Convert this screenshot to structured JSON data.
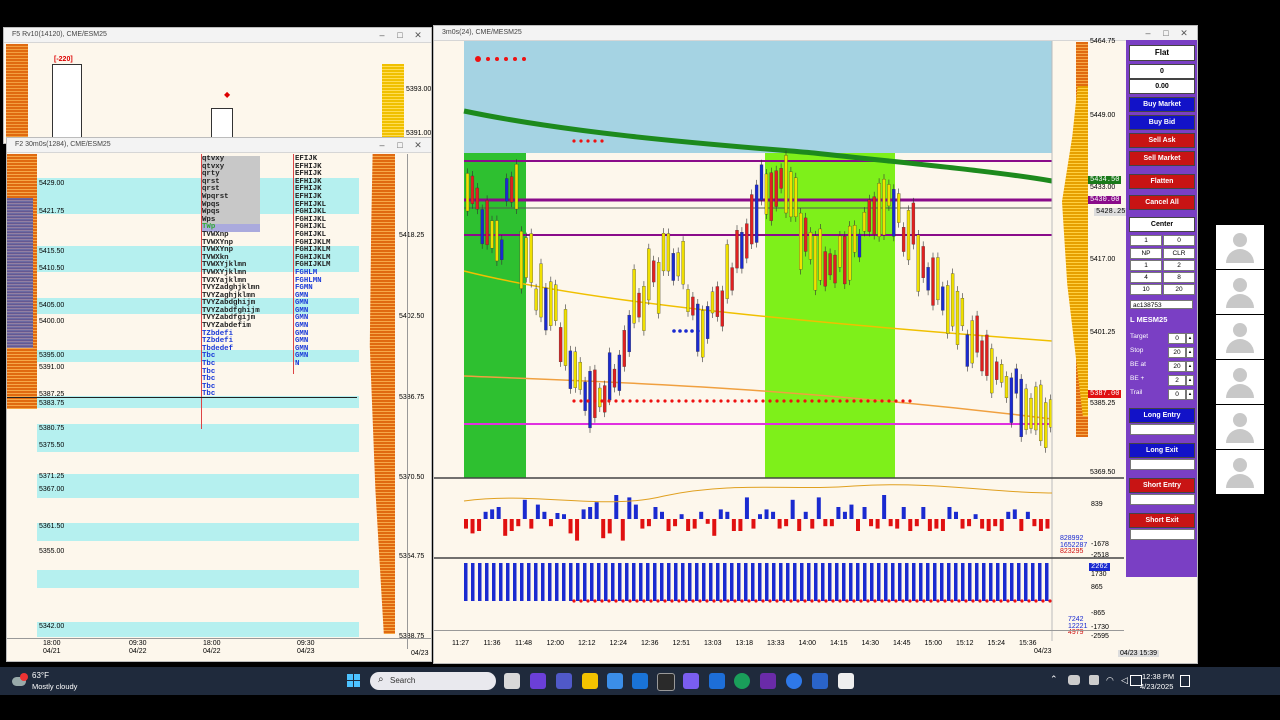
{
  "left_window": {
    "title": "F2 30m0s(1284), CME/ESM25",
    "mini_title": "F5 Rv10(14120), CME/ESM25",
    "mini_badge": "[-220]",
    "right_axis": [
      "5418.25",
      "5402.50",
      "5386.75",
      "5370.50",
      "5354.75",
      "5338.75"
    ],
    "mini_axis": [
      "5393.00",
      "5391.00"
    ],
    "price_labels": [
      "5429.00",
      "5421.75",
      "5415.50",
      "5410.50",
      "5405.00",
      "5400.00",
      "5395.00",
      "5391.00",
      "5387.25",
      "5383.75",
      "5380.75",
      "5375.50",
      "5371.25",
      "5367.00",
      "5361.50",
      "5355.00",
      "5342.00"
    ],
    "x_labels": [
      {
        "time": "18:00",
        "date": "04/21"
      },
      {
        "time": "09:30",
        "date": "04/22"
      },
      {
        "time": "18:00",
        "date": "04/22"
      },
      {
        "time": "09:30",
        "date": "04/23"
      }
    ],
    "corner_date": "04/23",
    "tpo_col1": [
      "qtvxy",
      "qtvxy",
      "qrty",
      "qrst",
      "qrst",
      "Wpqrst",
      "Wpqs",
      "Wpqs",
      "Wps",
      "TWp",
      "TVWXnp",
      "TVWXYnp",
      "TVWXYnp",
      "TVWXkn",
      "TVWXYjklmn",
      "TVWXYjklmn",
      "TVXYajklmn",
      "TVYZadghjklmn",
      "TVYZaghjklmn",
      "TVYZabdghijm",
      "TVYZabdfghijm",
      "TVYZabdfgijm",
      "TVYZabdefim",
      "TZbdefi",
      "TZbdefi",
      "Tbdedef",
      "Tbc",
      "Tbc",
      "Tbc",
      "Tbc",
      "Tbc",
      "Tbc"
    ],
    "tpo_col2": [
      "EFIJK",
      "EFHIJK",
      "EFHIJK",
      "EFHIJK",
      "EFHIJK",
      "EFHIJK",
      "EFHIJKL",
      "FGHIJKL",
      "FGHIJKL",
      "FGHIJKL",
      "FGHIJKL",
      "FGHIJKLM",
      "FGHIJKLM",
      "FGHIJKLM",
      "FGHIJKLM",
      "FGHLM",
      "FGHLMN",
      "FGMN",
      "GMN",
      "GMN",
      "GMN",
      "GMN",
      "GMN",
      "GMN",
      "GMN",
      "GMN",
      "GMN",
      "N"
    ]
  },
  "chart_window": {
    "title": "3m0s(24), CME/MESM25",
    "price_axis": [
      "5464.75",
      "5449.00",
      "5433.00",
      "5417.00",
      "5401.25",
      "5385.25",
      "5369.50"
    ],
    "price_tags": {
      "green": "5434.50",
      "red": "5430.00",
      "gray": "5428.25",
      "current": "5387.00"
    },
    "time_labels": [
      "11:27",
      "11:36",
      "11:48",
      "12:00",
      "12:12",
      "12:24",
      "12:36",
      "12:51",
      "13:03",
      "13:18",
      "13:33",
      "14:00",
      "14:15",
      "14:30",
      "14:45",
      "15:00",
      "15:12",
      "15:24",
      "15:36"
    ],
    "end_date": "04/23",
    "ind1_axis": [
      "839",
      "-1678",
      "-2518"
    ],
    "ind1_tags": [
      "828992",
      "1652287",
      "823295"
    ],
    "ind2_axis": [
      "1730",
      "865",
      "-865",
      "-1730",
      "-2595"
    ],
    "ind2_tags": [
      "7242",
      "12221",
      "4979"
    ],
    "ind2_tag_top": "2262",
    "footer_date": "04/23 15:39",
    "ind1_values": [
      -8,
      -12,
      -10,
      6,
      8,
      10,
      -14,
      -10,
      -6,
      16,
      -8,
      12,
      6,
      -6,
      5,
      4,
      -12,
      -18,
      8,
      10,
      14,
      -16,
      -12,
      20,
      -18,
      18,
      12,
      -8,
      -6,
      10,
      6,
      -10,
      -6,
      4,
      -10,
      -8,
      6,
      -4,
      -14,
      8,
      6,
      -10,
      -10,
      18,
      -8,
      4,
      8,
      6,
      -8,
      -6,
      16,
      -10,
      6,
      -8,
      18,
      -6,
      -6,
      10,
      6,
      12,
      -10,
      10,
      -6,
      -8,
      20,
      -6,
      -8,
      10,
      -10,
      -6,
      10,
      -10,
      -8,
      -10,
      10,
      6,
      -8,
      -6,
      4,
      -8,
      -10,
      -6,
      -10,
      6,
      8,
      -10,
      6,
      -6,
      -10,
      -8
    ],
    "ind2_count": 84
  },
  "trade_panel": {
    "position": "Flat",
    "qty": "0",
    "pnl": "0.00",
    "buy_market": "Buy Market",
    "buy_bid": "Buy Bid",
    "sell_ask": "Sell Ask",
    "sell_market": "Sell Market",
    "flatten": "Flatten",
    "cancel_all": "Cancel All",
    "center": "Center",
    "qty_field": "1",
    "qty_field2": "0",
    "grid": [
      [
        "NP",
        "CLR"
      ],
      [
        "1",
        "2"
      ],
      [
        "4",
        "8"
      ],
      [
        "10",
        "20"
      ]
    ],
    "account": "ac138753",
    "symbol": "L MESM25",
    "params": [
      {
        "label": "Target",
        "value": "0"
      },
      {
        "label": "Stop",
        "value": "20"
      },
      {
        "label": "BE at",
        "value": "20"
      },
      {
        "label": "BE +",
        "value": "2"
      },
      {
        "label": "Trail",
        "value": "0"
      }
    ],
    "long_entry": "Long Entry",
    "long_exit": "Long Exit",
    "short_entry": "Short Entry",
    "short_exit": "Short Exit"
  },
  "taskbar": {
    "weather_temp": "63°F",
    "weather_desc": "Mostly cloudy",
    "search_placeholder": "Search",
    "time": "12:38 PM",
    "date": "4/23/2025"
  }
}
